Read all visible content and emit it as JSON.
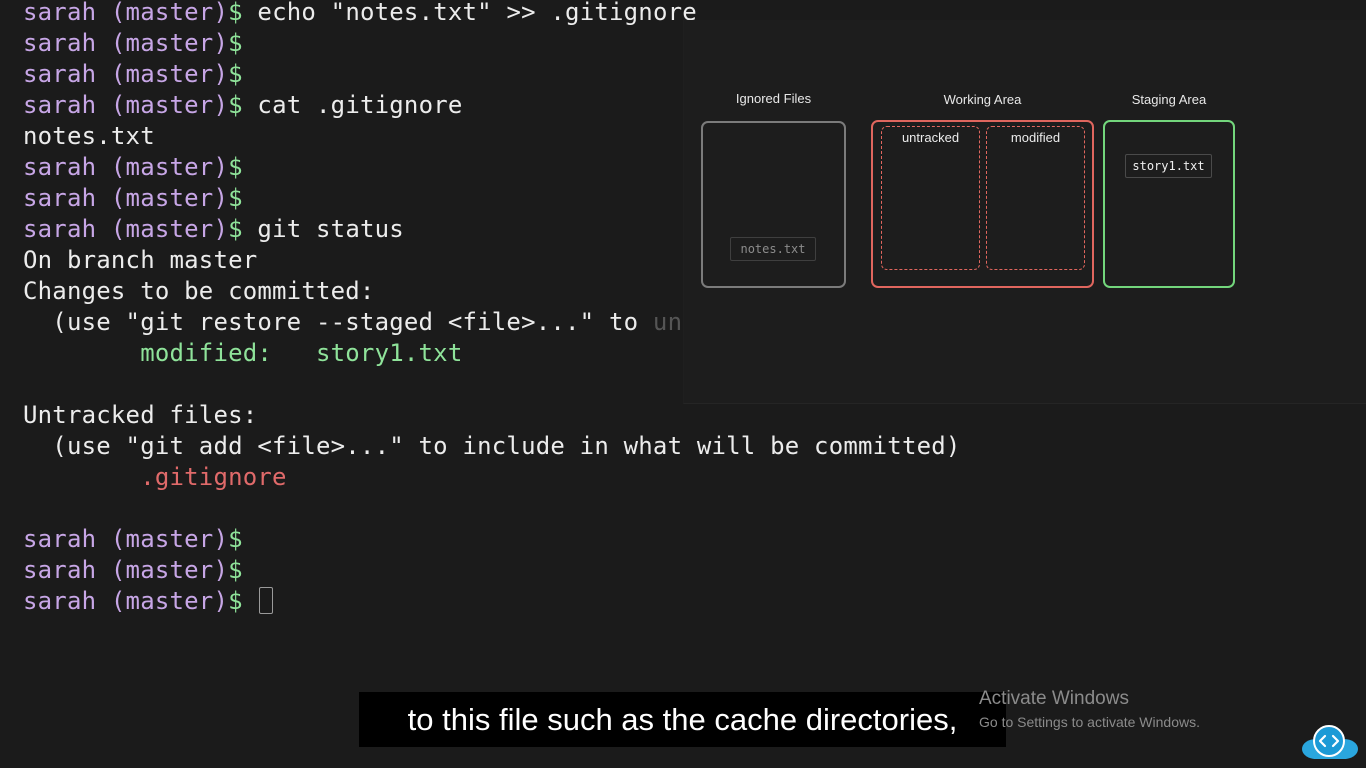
{
  "terminal": {
    "prompt": {
      "user": "sarah",
      "branch": "(master)",
      "symbol": "$"
    },
    "lines": {
      "l0_cmd": "echo \"notes.txt\" >> .gitignore",
      "l3_cmd": "cat .gitignore",
      "l4_out": "notes.txt",
      "l7_cmd": "git status",
      "l8_out": "On branch master",
      "l9_out": "Changes to be committed:",
      "l10_out_a": "  (use \"git restore --staged <file>...\" to ",
      "l10_out_b": "unstage)",
      "l11_label": "        modified:   ",
      "l11_file": "story1.txt",
      "l13_out": "Untracked files:",
      "l14_out": "  (use \"git add <file>...\" to include in what will be committed)",
      "l15_file": "        .gitignore"
    }
  },
  "diagram": {
    "ignored_title": "Ignored Files",
    "working_title": "Working Area",
    "staging_title": "Staging Area",
    "untracked_label": "untracked",
    "modified_label": "modified",
    "ignored_file": "notes.txt",
    "staged_file": "story1.txt",
    "colors": {
      "ignored_border": "#7b7b7b",
      "working_border": "#e0665e",
      "staging_border": "#73d67c"
    }
  },
  "caption": {
    "text": "to this file such as the cache directories,"
  },
  "watermark": {
    "title": "Activate Windows",
    "subtitle": "Go to Settings to activate Windows."
  },
  "logo": {
    "icon": "cloud-code-icon"
  }
}
